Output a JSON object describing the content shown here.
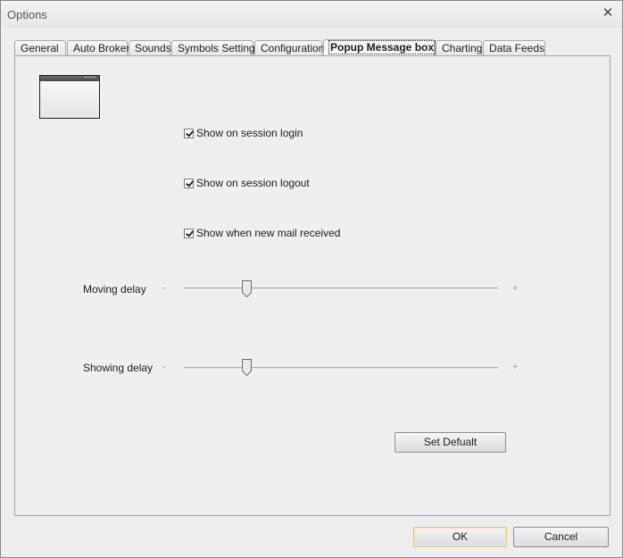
{
  "window": {
    "title": "Options"
  },
  "tabs": [
    {
      "label": "General"
    },
    {
      "label": "Auto Broker"
    },
    {
      "label": "Sounds"
    },
    {
      "label": "Symbols Settings"
    },
    {
      "label": "Configuration"
    },
    {
      "label": "Popup Message box",
      "active": true
    },
    {
      "label": "Charting"
    },
    {
      "label": "Data Feeds"
    }
  ],
  "popup": {
    "checkboxes": [
      {
        "label": "Show on session login",
        "checked": true
      },
      {
        "label": "Show on session logout",
        "checked": true
      },
      {
        "label": "Show when new mail received",
        "checked": true
      }
    ],
    "moving_delay": {
      "label": "Moving delay",
      "minus": "-",
      "plus": "+",
      "value": 0.2
    },
    "showing_delay": {
      "label": "Showing delay",
      "minus": "-",
      "plus": "+",
      "value": 0.2
    },
    "set_default_label": "Set Defualt"
  },
  "footer": {
    "ok_label": "OK",
    "cancel_label": "Cancel"
  },
  "icons": {
    "close": "close-icon",
    "preview": "popup-window-preview-icon"
  }
}
